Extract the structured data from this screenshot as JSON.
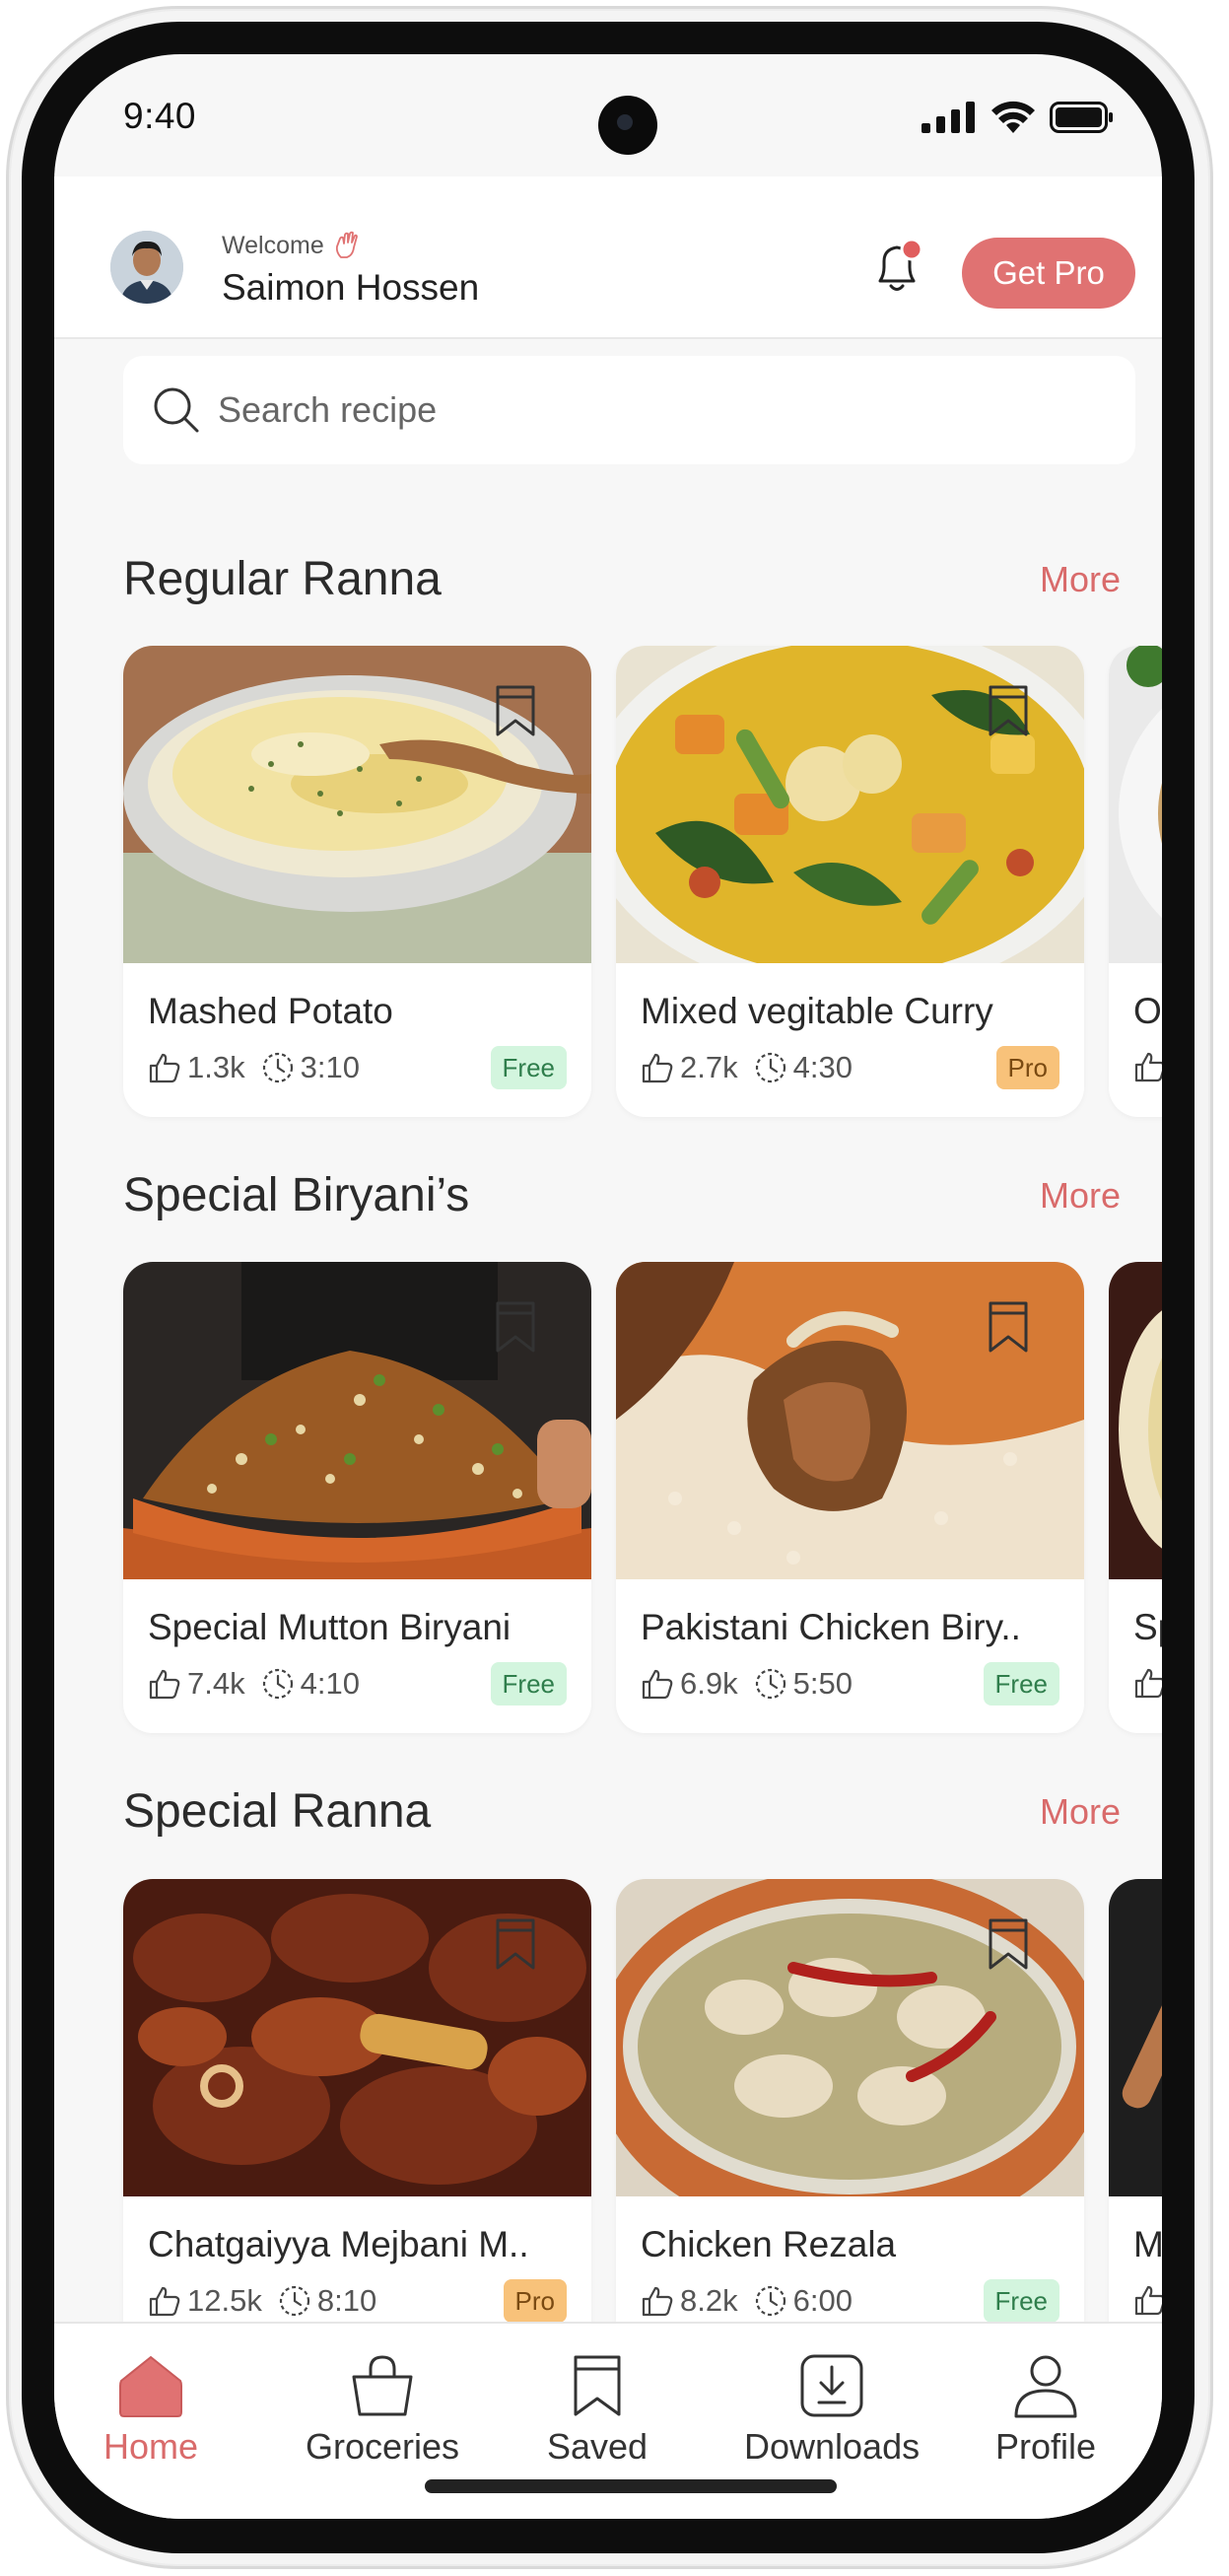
{
  "status_bar": {
    "time": "9:40"
  },
  "header": {
    "welcome_label": "Welcome",
    "user_name": "Saimon Hossen",
    "get_pro_label": "Get Pro"
  },
  "search": {
    "placeholder": "Search recipe"
  },
  "sections": [
    {
      "title": "Regular Ranna",
      "more_label": "More",
      "cards": [
        {
          "title": "Mashed Potato",
          "likes": "1.3k",
          "duration": "3:10",
          "badge": "Free"
        },
        {
          "title": "Mixed vegitable Curry",
          "likes": "2.7k",
          "duration": "4:30",
          "badge": "Pro"
        },
        {
          "title": "On"
        }
      ]
    },
    {
      "title": "Special Biryani’s",
      "more_label": "More",
      "cards": [
        {
          "title": "Special Mutton Biryani",
          "likes": "7.4k",
          "duration": "4:10",
          "badge": "Free"
        },
        {
          "title": "Pakistani Chicken Biry..",
          "likes": "6.9k",
          "duration": "5:50",
          "badge": "Free"
        },
        {
          "title": "Sp"
        }
      ]
    },
    {
      "title": "Special Ranna",
      "more_label": "More",
      "cards": [
        {
          "title": "Chatgaiyya Mejbani M..",
          "likes": "12.5k",
          "duration": "8:10",
          "badge": "Pro"
        },
        {
          "title": "Chicken Rezala",
          "likes": "8.2k",
          "duration": "6:00",
          "badge": "Free"
        },
        {
          "title": "Me"
        }
      ]
    }
  ],
  "bottom_nav": [
    {
      "label": "Home",
      "icon": "home-icon",
      "active": true
    },
    {
      "label": "Groceries",
      "icon": "shopping-bag-icon",
      "active": false
    },
    {
      "label": "Saved",
      "icon": "bookmark-icon",
      "active": false
    },
    {
      "label": "Downloads",
      "icon": "download-icon",
      "active": false
    },
    {
      "label": "Profile",
      "icon": "profile-icon",
      "active": false
    }
  ],
  "colors": {
    "accent": "#e07272",
    "more_text": "#d96b6b",
    "free_badge_bg": "#d3f5de",
    "pro_badge_bg": "#f8c27a",
    "screen_bg": "#f7f7f7"
  }
}
